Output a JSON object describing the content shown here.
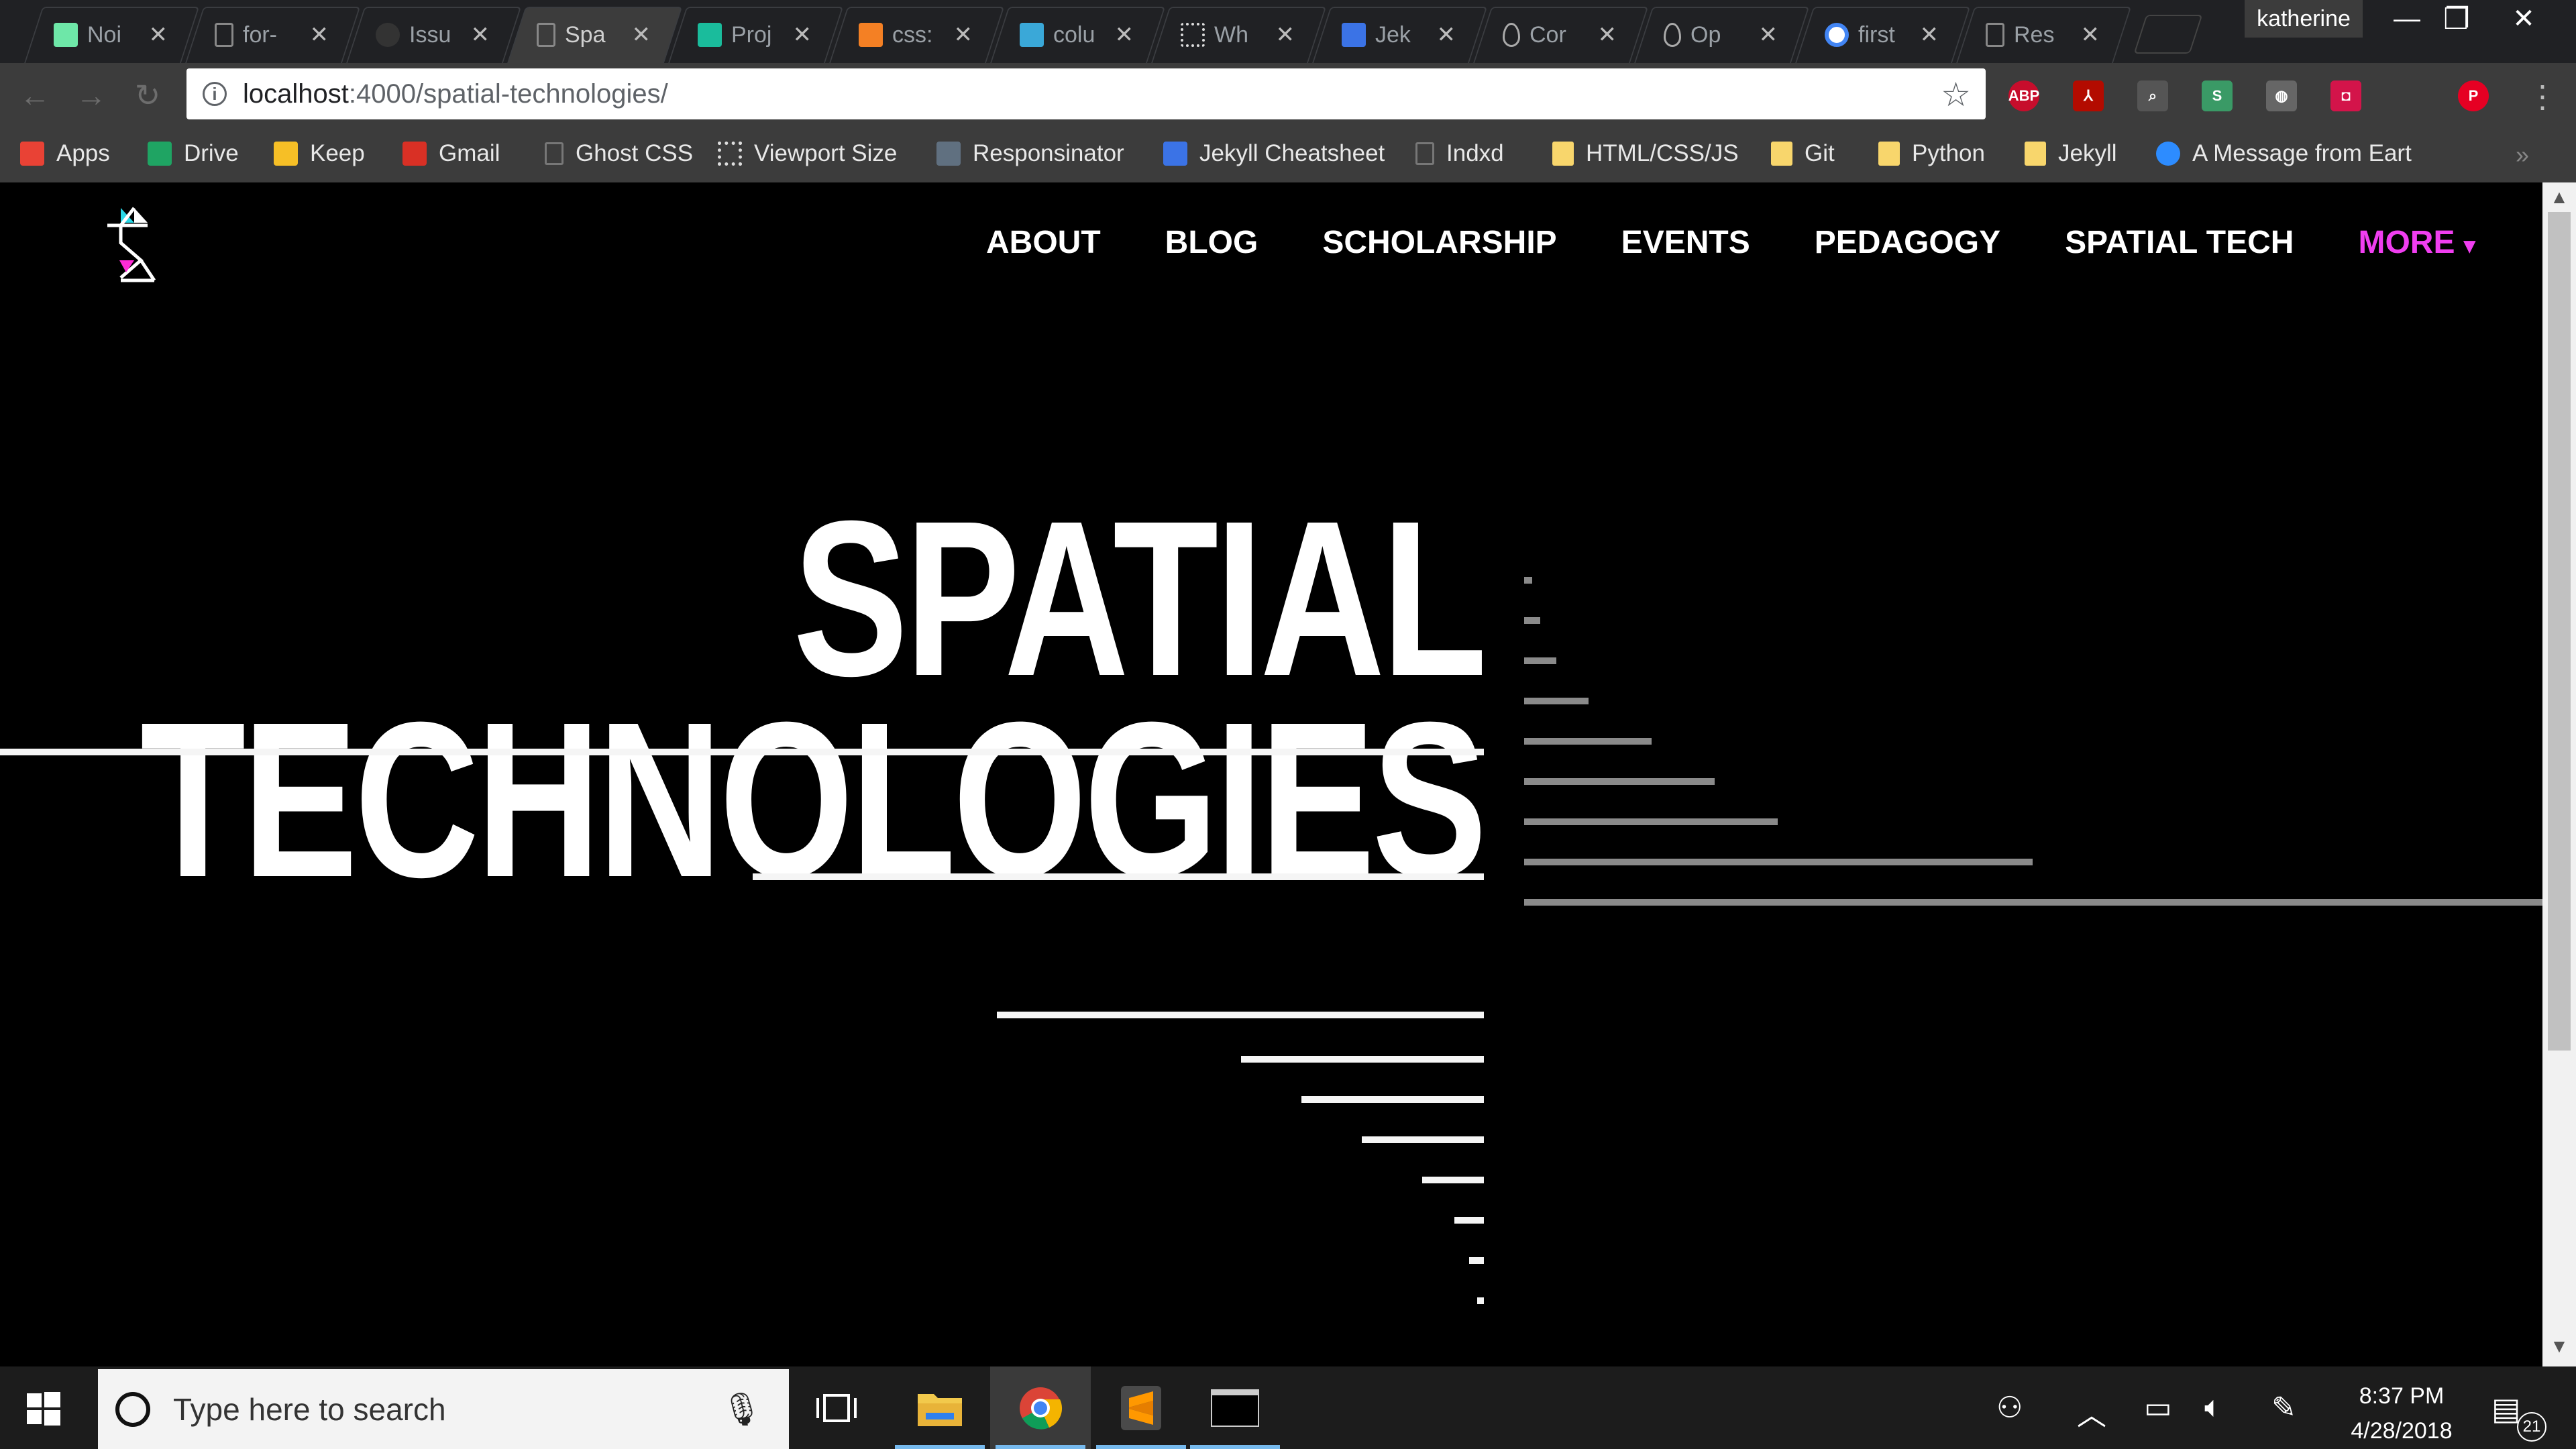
{
  "browser": {
    "tabs": [
      {
        "title": "Noi",
        "icon": "notion-icon",
        "color": "#6ee7a8"
      },
      {
        "title": "for-",
        "icon": "page-icon"
      },
      {
        "title": "Issu",
        "icon": "github-icon"
      },
      {
        "title": "Spa",
        "icon": "page-icon",
        "active": true
      },
      {
        "title": "Proj",
        "icon": "teal-square-icon",
        "color": "#1abc9c"
      },
      {
        "title": "css:",
        "icon": "stackoverflow-icon"
      },
      {
        "title": "colu",
        "icon": "bird-icon"
      },
      {
        "title": "Wh",
        "icon": "grid-icon"
      },
      {
        "title": "Jek",
        "icon": "jekyll-icon"
      },
      {
        "title": "Cor",
        "icon": "drop-icon"
      },
      {
        "title": "Op",
        "icon": "drop-icon"
      },
      {
        "title": "first",
        "icon": "google-icon"
      },
      {
        "title": "Res",
        "icon": "page-icon"
      }
    ],
    "tab_close_glyph": "✕",
    "profile_name": "katherine",
    "window_controls": {
      "minimize": "—",
      "restore": "❐",
      "close": "✕"
    },
    "url_host": "localhost",
    "url_path": ":4000/spatial-technologies/",
    "extensions": [
      {
        "name": "adblock-plus-icon",
        "label": "ABP",
        "color": "#c70d2c"
      },
      {
        "name": "acrobat-icon",
        "label": "⅄",
        "color": "#b30b00"
      },
      {
        "name": "search-page-icon",
        "label": "⌕",
        "color": "#555555"
      },
      {
        "name": "s-extension-icon",
        "label": "S",
        "color": "#3a9a66"
      },
      {
        "name": "bulb-extension-icon",
        "label": "◍",
        "color": "#666666"
      },
      {
        "name": "pocket-icon",
        "label": "◘",
        "color": "#d3144a"
      },
      {
        "name": "pinterest-icon",
        "label": "P",
        "color": "#e60023"
      }
    ],
    "bookmarks": [
      {
        "label": "Apps",
        "icon": "apps-grid-icon"
      },
      {
        "label": "Drive",
        "icon": "drive-icon"
      },
      {
        "label": "Keep",
        "icon": "keep-icon"
      },
      {
        "label": "Gmail",
        "icon": "gmail-icon"
      },
      {
        "label": "Ghost CSS",
        "icon": "page-icon"
      },
      {
        "label": "Viewport Size",
        "icon": "dots-icon"
      },
      {
        "label": "Responsinator",
        "icon": "r-icon"
      },
      {
        "label": "Jekyll Cheatsheet",
        "icon": "jekyll-icon"
      },
      {
        "label": "Indxd",
        "icon": "page-icon"
      },
      {
        "label": "HTML/CSS/JS",
        "icon": "folder-icon"
      },
      {
        "label": "Git",
        "icon": "folder-icon"
      },
      {
        "label": "Python",
        "icon": "folder-icon"
      },
      {
        "label": "Jekyll",
        "icon": "folder-icon"
      },
      {
        "label": "A Message from Eart",
        "icon": "earth-icon"
      }
    ],
    "bookmarks_overflow": "»"
  },
  "site": {
    "nav": [
      "ABOUT",
      "BLOG",
      "SCHOLARSHIP",
      "EVENTS",
      "PEDAGOGY",
      "SPATIAL TECH"
    ],
    "nav_more": "MORE",
    "nav_more_caret": "▾",
    "accent": "#f03ef0",
    "hero_line1": "SPATIAL",
    "hero_line2": "TECHNOLOGIES",
    "logo_colors": {
      "cyan": "#29d9e8",
      "magenta": "#ff2bd6"
    }
  },
  "taskbar": {
    "search_placeholder": "Type here to search",
    "time": "8:37 PM",
    "date": "4/28/2018",
    "notification_count": "21",
    "apps": [
      "task-view-icon",
      "file-explorer-icon",
      "chrome-icon",
      "sublime-text-icon",
      "terminal-icon"
    ]
  }
}
